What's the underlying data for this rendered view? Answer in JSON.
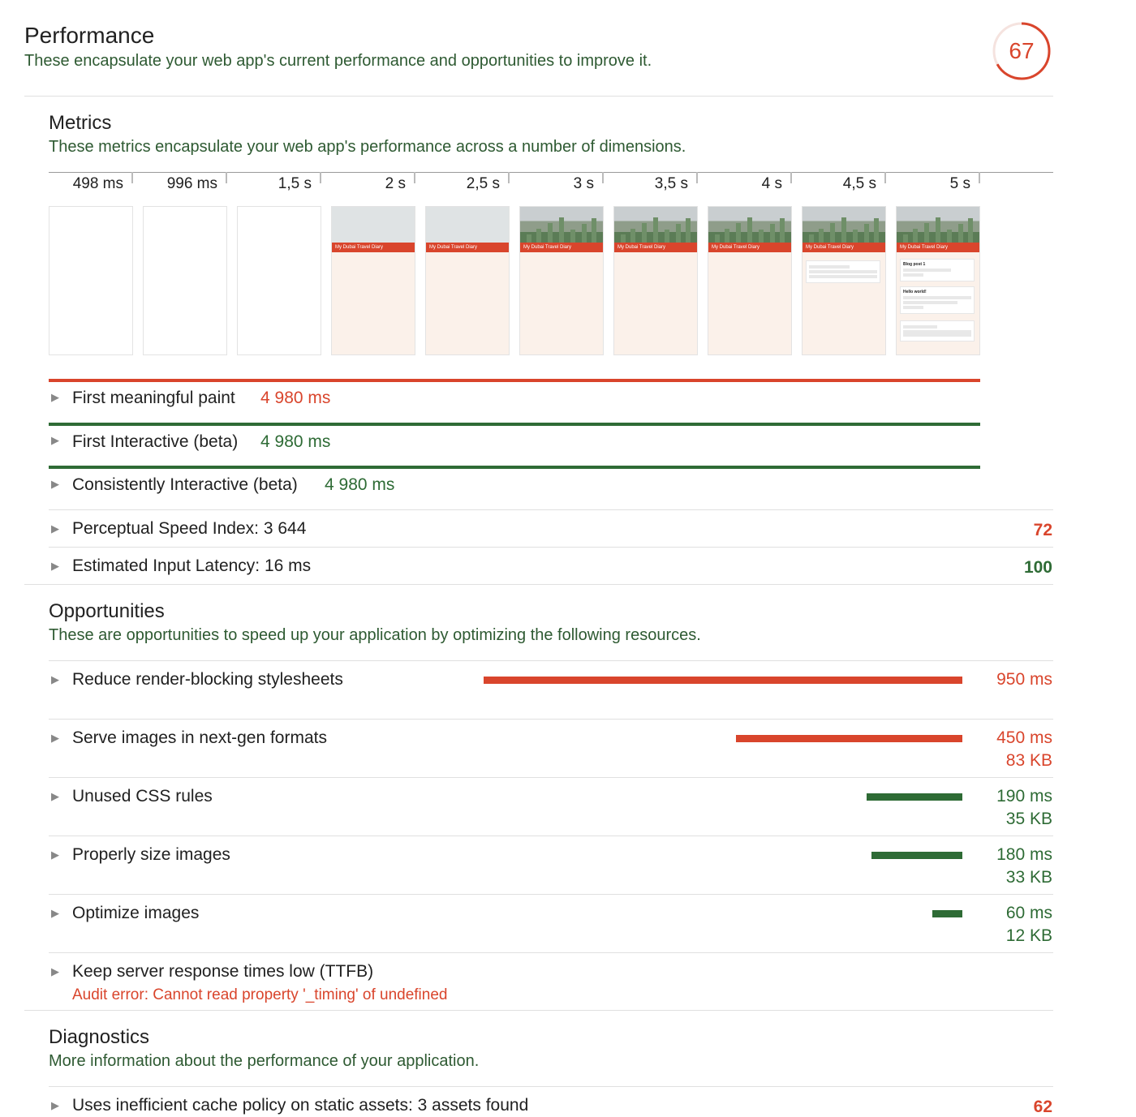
{
  "performance": {
    "title": "Performance",
    "description": "These encapsulate your web app's current performance and opportunities to improve it.",
    "score": "67",
    "score_fraction": 0.67
  },
  "metrics": {
    "title": "Metrics",
    "description": "These metrics encapsulate your web app's performance across a number of dimensions.",
    "timeline": [
      "498 ms",
      "996 ms",
      "1,5 s",
      "2 s",
      "2,5 s",
      "3 s",
      "3,5 s",
      "4 s",
      "4,5 s",
      "5 s"
    ],
    "frame_banner_text": "My Dubai Travel Diary",
    "frame_post1": "Blog post 1",
    "frame_post2": "Hello world!",
    "items": [
      {
        "label": "First meaningful paint",
        "value": "4 980 ms",
        "status": "fail"
      },
      {
        "label": "First Interactive (beta)",
        "value": "4 980 ms",
        "status": "pass"
      },
      {
        "label": "Consistently Interactive (beta)",
        "value": "4 980 ms",
        "status": "pass"
      },
      {
        "label": "Perceptual Speed Index: 3 644",
        "score": "72",
        "status": "fail"
      },
      {
        "label": "Estimated Input Latency: 16 ms",
        "score": "100",
        "status": "pass"
      }
    ]
  },
  "opportunities": {
    "title": "Opportunities",
    "description": "These are opportunities to speed up your application by optimizing the following resources.",
    "items": [
      {
        "label": "Reduce render-blocking stylesheets",
        "time": "950 ms",
        "size": "",
        "savings_ms": 950,
        "status": "fail"
      },
      {
        "label": "Serve images in next-gen formats",
        "time": "450 ms",
        "size": "83 KB",
        "savings_ms": 450,
        "status": "fail"
      },
      {
        "label": "Unused CSS rules",
        "time": "190 ms",
        "size": "35 KB",
        "savings_ms": 190,
        "status": "pass"
      },
      {
        "label": "Properly size images",
        "time": "180 ms",
        "size": "33 KB",
        "savings_ms": 180,
        "status": "pass"
      },
      {
        "label": "Optimize images",
        "time": "60 ms",
        "size": "12 KB",
        "savings_ms": 60,
        "status": "pass"
      },
      {
        "label": "Keep server response times low (TTFB)",
        "error": "Audit error: Cannot read property '_timing' of undefined"
      }
    ]
  },
  "diagnostics": {
    "title": "Diagnostics",
    "description": "More information about the performance of your application.",
    "items": [
      {
        "label": "Uses inefficient cache policy on static assets: 3 assets found",
        "score": "62",
        "status": "fail"
      }
    ]
  },
  "colors": {
    "fail": "#d9452c",
    "pass": "#2e6b35"
  }
}
